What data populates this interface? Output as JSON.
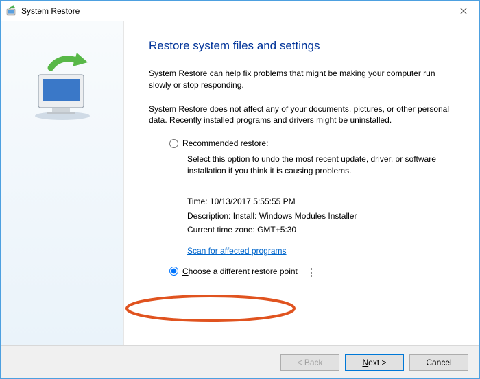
{
  "titlebar": {
    "title": "System Restore"
  },
  "heading": "Restore system files and settings",
  "para1": "System Restore can help fix problems that might be making your computer run slowly or stop responding.",
  "para2": "System Restore does not affect any of your documents, pictures, or other personal data. Recently installed programs and drivers might be uninstalled.",
  "recommended": {
    "label": "Recommended restore:",
    "desc": "Select this option to undo the most recent update, driver, or software installation if you think it is causing problems.",
    "time_label": "Time:",
    "time_value": "10/13/2017 5:55:55 PM",
    "desc_label": "Description:",
    "desc_value": "Install: Windows Modules Installer",
    "tz_label": "Current time zone:",
    "tz_value": "GMT+5:30",
    "scan_link": "Scan for affected programs"
  },
  "choose": {
    "label": "Choose a different restore point"
  },
  "buttons": {
    "back": "< Back",
    "next": "Next >",
    "cancel": "Cancel"
  }
}
